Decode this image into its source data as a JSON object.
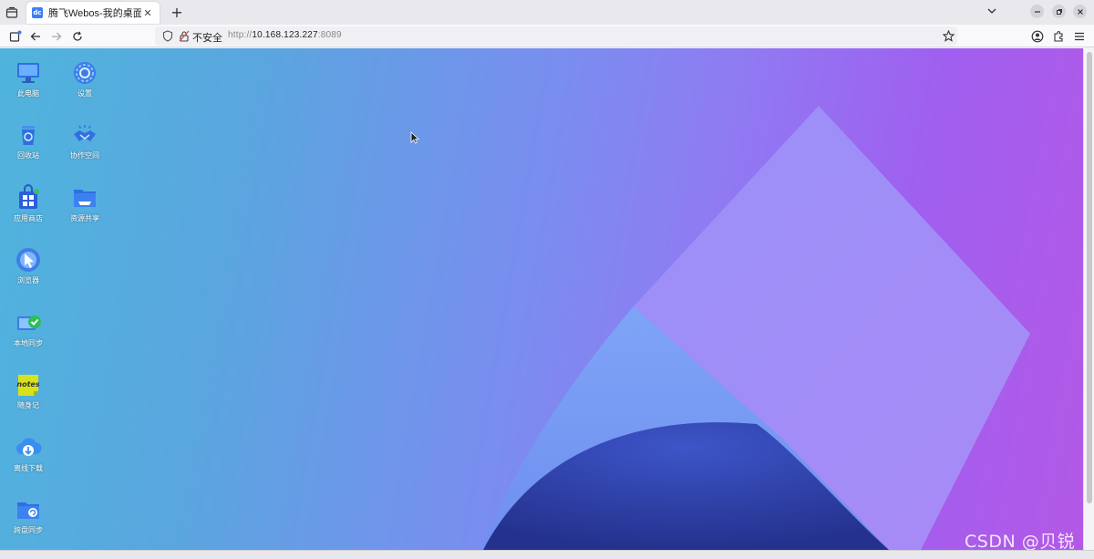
{
  "browser": {
    "tab_title": "腾飞Webos-我的桌面",
    "favicon_text": "dc",
    "insecure_label": "不安全",
    "url_scheme": "http://",
    "url_host": "10.168.123.227",
    "url_port": ":8089"
  },
  "desktop": {
    "icons": [
      {
        "label": "此电脑",
        "icon": "computer-icon"
      },
      {
        "label": "设置",
        "icon": "settings-icon"
      },
      {
        "label": "回收站",
        "icon": "recycle-bin-icon"
      },
      {
        "label": "协作空间",
        "icon": "handshake-icon"
      },
      {
        "label": "应用商店",
        "icon": "app-store-icon"
      },
      {
        "label": "资源共享",
        "icon": "shared-folder-icon"
      },
      {
        "label": "浏览器",
        "icon": "browser-icon"
      },
      {
        "label": "本地同步",
        "icon": "local-sync-icon"
      },
      {
        "label": "随身记",
        "icon": "notes-icon",
        "glyph_text": "notes"
      },
      {
        "label": "离线下载",
        "icon": "cloud-download-icon"
      },
      {
        "label": "跨盘同步",
        "icon": "cross-disk-sync-icon"
      }
    ],
    "watermark": "CSDN @贝锐"
  },
  "colors": {
    "wallpaper_left": "#4fb4dd",
    "wallpaper_mid": "#7a8df0",
    "wallpaper_right": "#b458e6",
    "favicon": "#3d7ef5"
  }
}
